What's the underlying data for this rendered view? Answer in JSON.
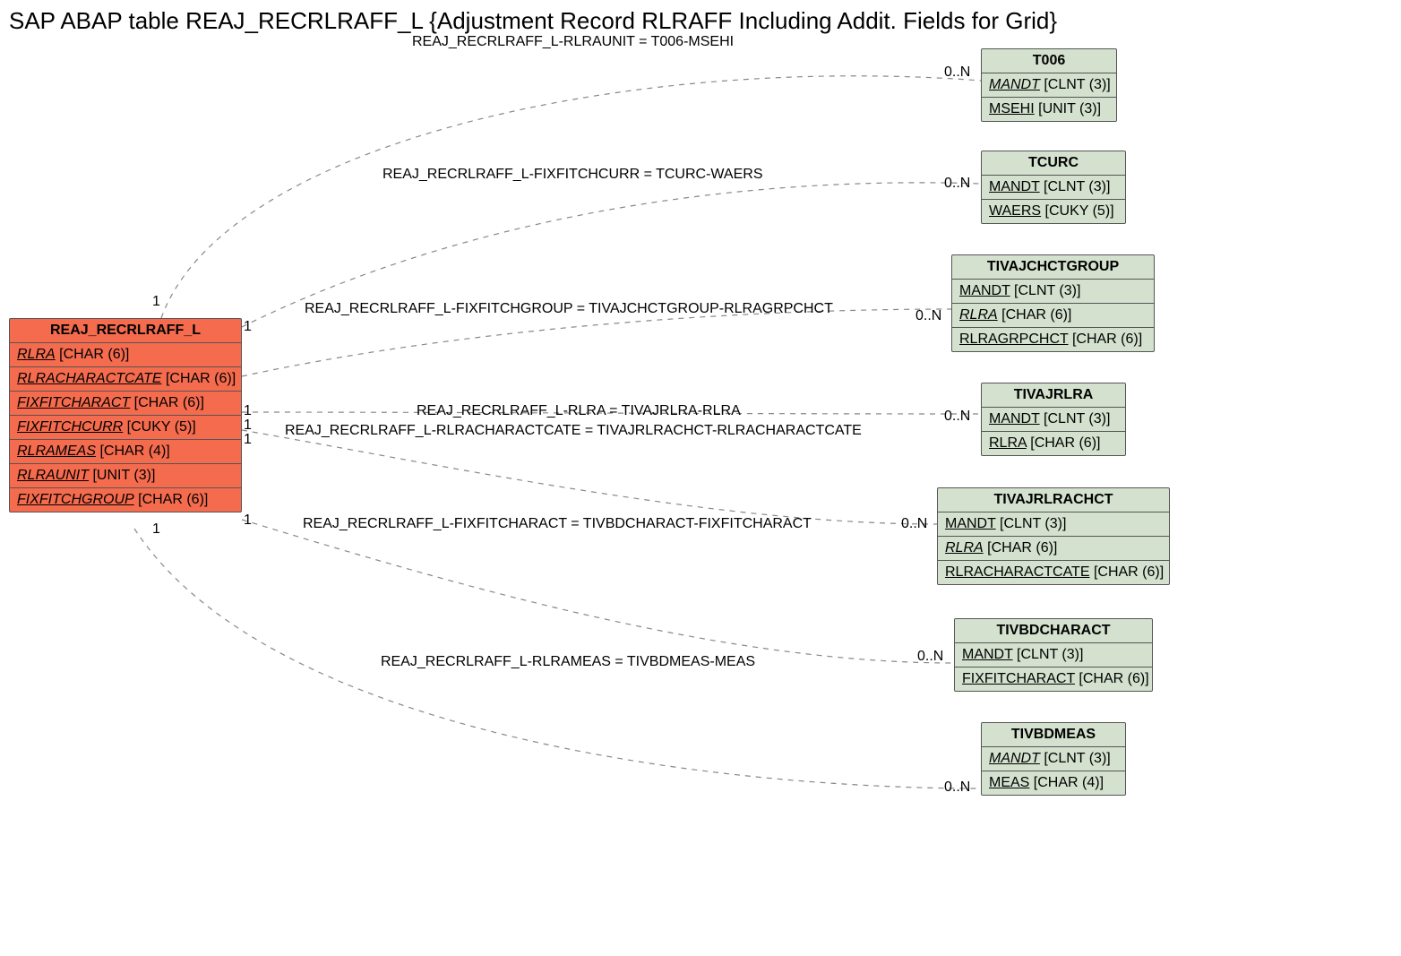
{
  "title": "SAP ABAP table REAJ_RECRLRAFF_L {Adjustment Record RLRAFF Including Addit. Fields for Grid}",
  "main": {
    "name": "REAJ_RECRLRAFF_L",
    "fields": [
      {
        "name": "RLRA",
        "type": "[CHAR (6)]",
        "italic": true
      },
      {
        "name": "RLRACHARACTCATE",
        "type": "[CHAR (6)]",
        "italic": true
      },
      {
        "name": "FIXFITCHARACT",
        "type": "[CHAR (6)]",
        "italic": true
      },
      {
        "name": "FIXFITCHCURR",
        "type": "[CUKY (5)]",
        "italic": true
      },
      {
        "name": "RLRAMEAS",
        "type": "[CHAR (4)]",
        "italic": true
      },
      {
        "name": "RLRAUNIT",
        "type": "[UNIT (3)]",
        "italic": true
      },
      {
        "name": "FIXFITCHGROUP",
        "type": "[CHAR (6)]",
        "italic": true
      }
    ]
  },
  "related": [
    {
      "key": "t006",
      "name": "T006",
      "fields": [
        {
          "name": "MANDT",
          "type": "[CLNT (3)]",
          "italic": true
        },
        {
          "name": "MSEHI",
          "type": "[UNIT (3)]",
          "italic": false
        }
      ]
    },
    {
      "key": "tcurc",
      "name": "TCURC",
      "fields": [
        {
          "name": "MANDT",
          "type": "[CLNT (3)]",
          "italic": false
        },
        {
          "name": "WAERS",
          "type": "[CUKY (5)]",
          "italic": false
        }
      ]
    },
    {
      "key": "tivajchctgroup",
      "name": "TIVAJCHCTGROUP",
      "fields": [
        {
          "name": "MANDT",
          "type": "[CLNT (3)]",
          "italic": false
        },
        {
          "name": "RLRA",
          "type": "[CHAR (6)]",
          "italic": true
        },
        {
          "name": "RLRAGRPCHCT",
          "type": "[CHAR (6)]",
          "italic": false
        }
      ]
    },
    {
      "key": "tivajrlra",
      "name": "TIVAJRLRA",
      "fields": [
        {
          "name": "MANDT",
          "type": "[CLNT (3)]",
          "italic": false
        },
        {
          "name": "RLRA",
          "type": "[CHAR (6)]",
          "italic": false
        }
      ]
    },
    {
      "key": "tivajrlrachct",
      "name": "TIVAJRLRACHCT",
      "fields": [
        {
          "name": "MANDT",
          "type": "[CLNT (3)]",
          "italic": false
        },
        {
          "name": "RLRA",
          "type": "[CHAR (6)]",
          "italic": true
        },
        {
          "name": "RLRACHARACTCATE",
          "type": "[CHAR (6)]",
          "italic": false
        }
      ]
    },
    {
      "key": "tivbdcharact",
      "name": "TIVBDCHARACT",
      "fields": [
        {
          "name": "MANDT",
          "type": "[CLNT (3)]",
          "italic": false
        },
        {
          "name": "FIXFITCHARACT",
          "type": "[CHAR (6)]",
          "italic": false
        }
      ]
    },
    {
      "key": "tivbdmeas",
      "name": "TIVBDMEAS",
      "fields": [
        {
          "name": "MANDT",
          "type": "[CLNT (3)]",
          "italic": true
        },
        {
          "name": "MEAS",
          "type": "[CHAR (4)]",
          "italic": false
        }
      ]
    }
  ],
  "edges": [
    {
      "label": "REAJ_RECRLRAFF_L-RLRAUNIT = T006-MSEHI",
      "left_card": "1",
      "right_card": "0..N"
    },
    {
      "label": "REAJ_RECRLRAFF_L-FIXFITCHCURR = TCURC-WAERS",
      "left_card": "1",
      "right_card": "0..N"
    },
    {
      "label": "REAJ_RECRLRAFF_L-FIXFITCHGROUP = TIVAJCHCTGROUP-RLRAGRPCHCT",
      "left_card": "1",
      "right_card": "0..N"
    },
    {
      "label": "REAJ_RECRLRAFF_L-RLRA = TIVAJRLRA-RLRA",
      "left_card": "1",
      "right_card": "0..N"
    },
    {
      "label": "REAJ_RECRLRAFF_L-RLRACHARACTCATE = TIVAJRLRACHCT-RLRACHARACTCATE",
      "left_card": "1",
      "right_card": "0..N"
    },
    {
      "label": "REAJ_RECRLRAFF_L-FIXFITCHARACT = TIVBDCHARACT-FIXFITCHARACT",
      "left_card": "1",
      "right_card": "0..N"
    },
    {
      "label": "REAJ_RECRLRAFF_L-RLRAMEAS = TIVBDMEAS-MEAS",
      "left_card": "1",
      "right_card": "0..N"
    }
  ]
}
